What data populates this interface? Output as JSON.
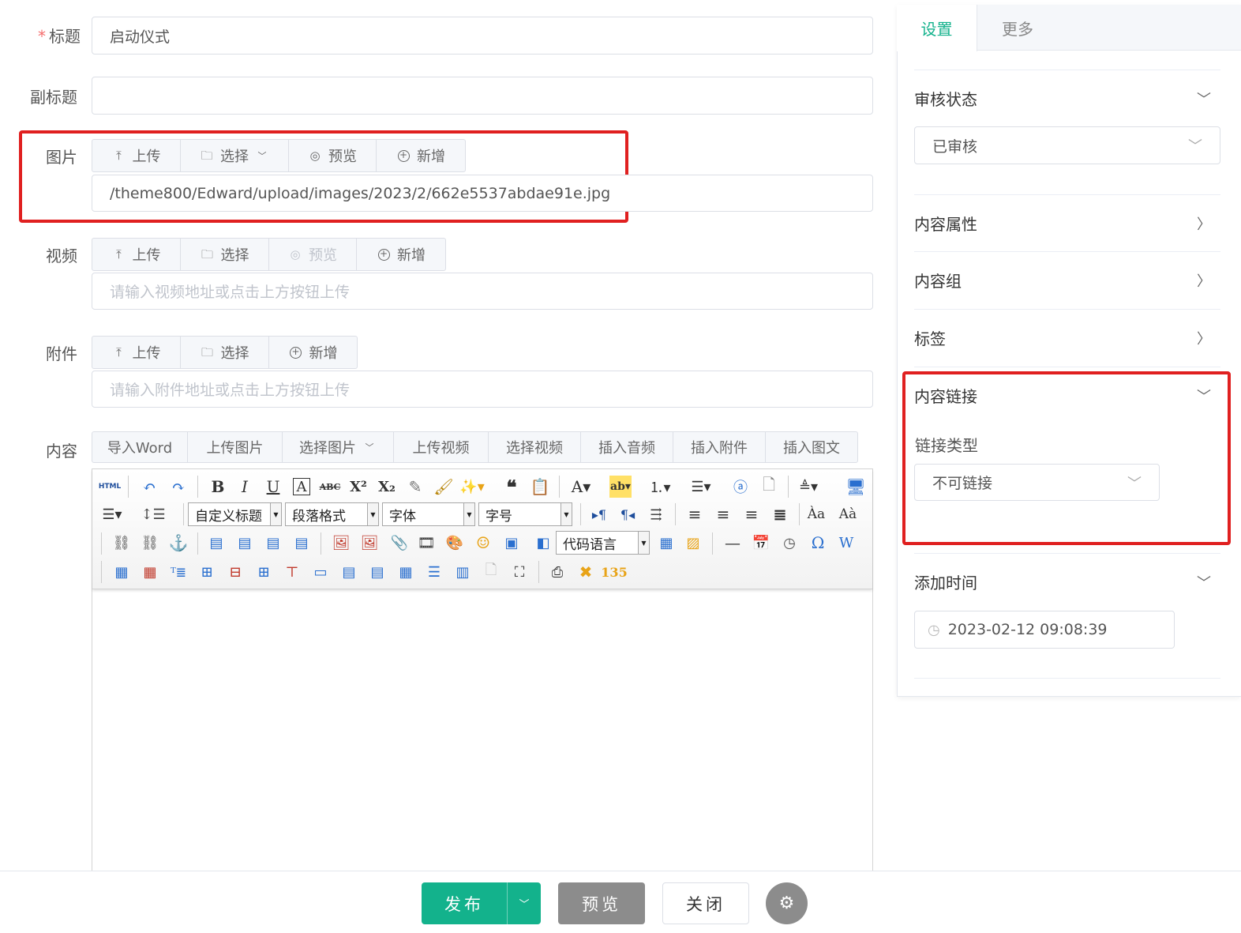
{
  "form": {
    "title_label": "标题",
    "title_required": "*",
    "title_value": "启动仪式",
    "subtitle_label": "副标题",
    "subtitle_value": "",
    "image_label": "图片",
    "image_buttons": {
      "upload": "上传",
      "select": "选择",
      "preview": "预览",
      "add": "新增"
    },
    "image_value": "/theme800/Edward/upload/images/2023/2/662e5537abdae91e.jpg",
    "video_label": "视频",
    "video_buttons": {
      "upload": "上传",
      "select": "选择",
      "preview": "预览",
      "add": "新增"
    },
    "video_placeholder": "请输入视频地址或点击上方按钮上传",
    "attach_label": "附件",
    "attach_buttons": {
      "upload": "上传",
      "select": "选择",
      "add": "新增"
    },
    "attach_placeholder": "请输入附件地址或点击上方按钮上传",
    "content_label": "内容",
    "content_buttons": [
      "导入Word",
      "上传图片",
      "选择图片",
      "上传视频",
      "选择视频",
      "插入音频",
      "插入附件",
      "插入图文"
    ]
  },
  "editor": {
    "selects": {
      "heading": "自定义标题",
      "paragraph": "段落格式",
      "font": "字体",
      "size": "字号",
      "code": "代码语言"
    }
  },
  "sidebar": {
    "tabs": [
      "设置",
      "更多"
    ],
    "review_status_label": "审核状态",
    "review_status_value": "已审核",
    "content_props_label": "内容属性",
    "content_group_label": "内容组",
    "tags_label": "标签",
    "content_link_label": "内容链接",
    "link_type_label": "链接类型",
    "link_type_value": "不可链接",
    "add_time_label": "添加时间",
    "add_time_value": "2023-02-12 09:08:39"
  },
  "footer": {
    "publish": "发布",
    "preview": "预览",
    "close": "关闭"
  },
  "colors": {
    "primary": "#13b28c",
    "highlight": "#e02020",
    "grey_btn": "#8c8c8c"
  }
}
